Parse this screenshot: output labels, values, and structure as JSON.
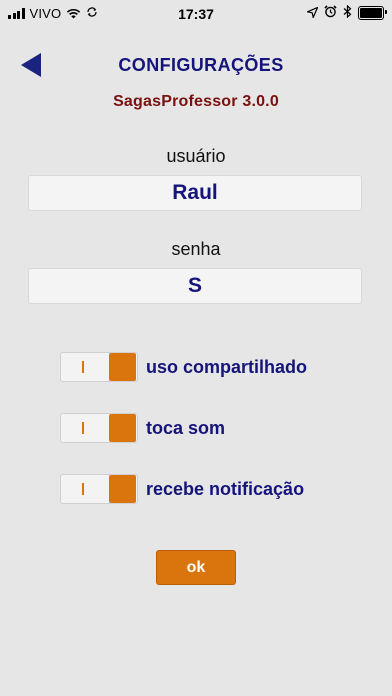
{
  "status_bar": {
    "carrier": "VIVO",
    "time": "17:37"
  },
  "header": {
    "title": "CONFIGURAÇÕES",
    "version": "SagasProfessor 3.0.0"
  },
  "form": {
    "username_label": "usuário",
    "username_value": "Raul",
    "password_label": "senha",
    "password_value": "S"
  },
  "toggles": [
    {
      "label": "uso compartilhado",
      "on": true
    },
    {
      "label": "toca som",
      "on": true
    },
    {
      "label": "recebe notificação",
      "on": true
    }
  ],
  "actions": {
    "ok_label": "ok"
  },
  "colors": {
    "background": "#e6e6e6",
    "title": "#14147a",
    "version": "#7a1010",
    "accent_orange": "#d9750c",
    "back_arrow": "#1a237e"
  }
}
